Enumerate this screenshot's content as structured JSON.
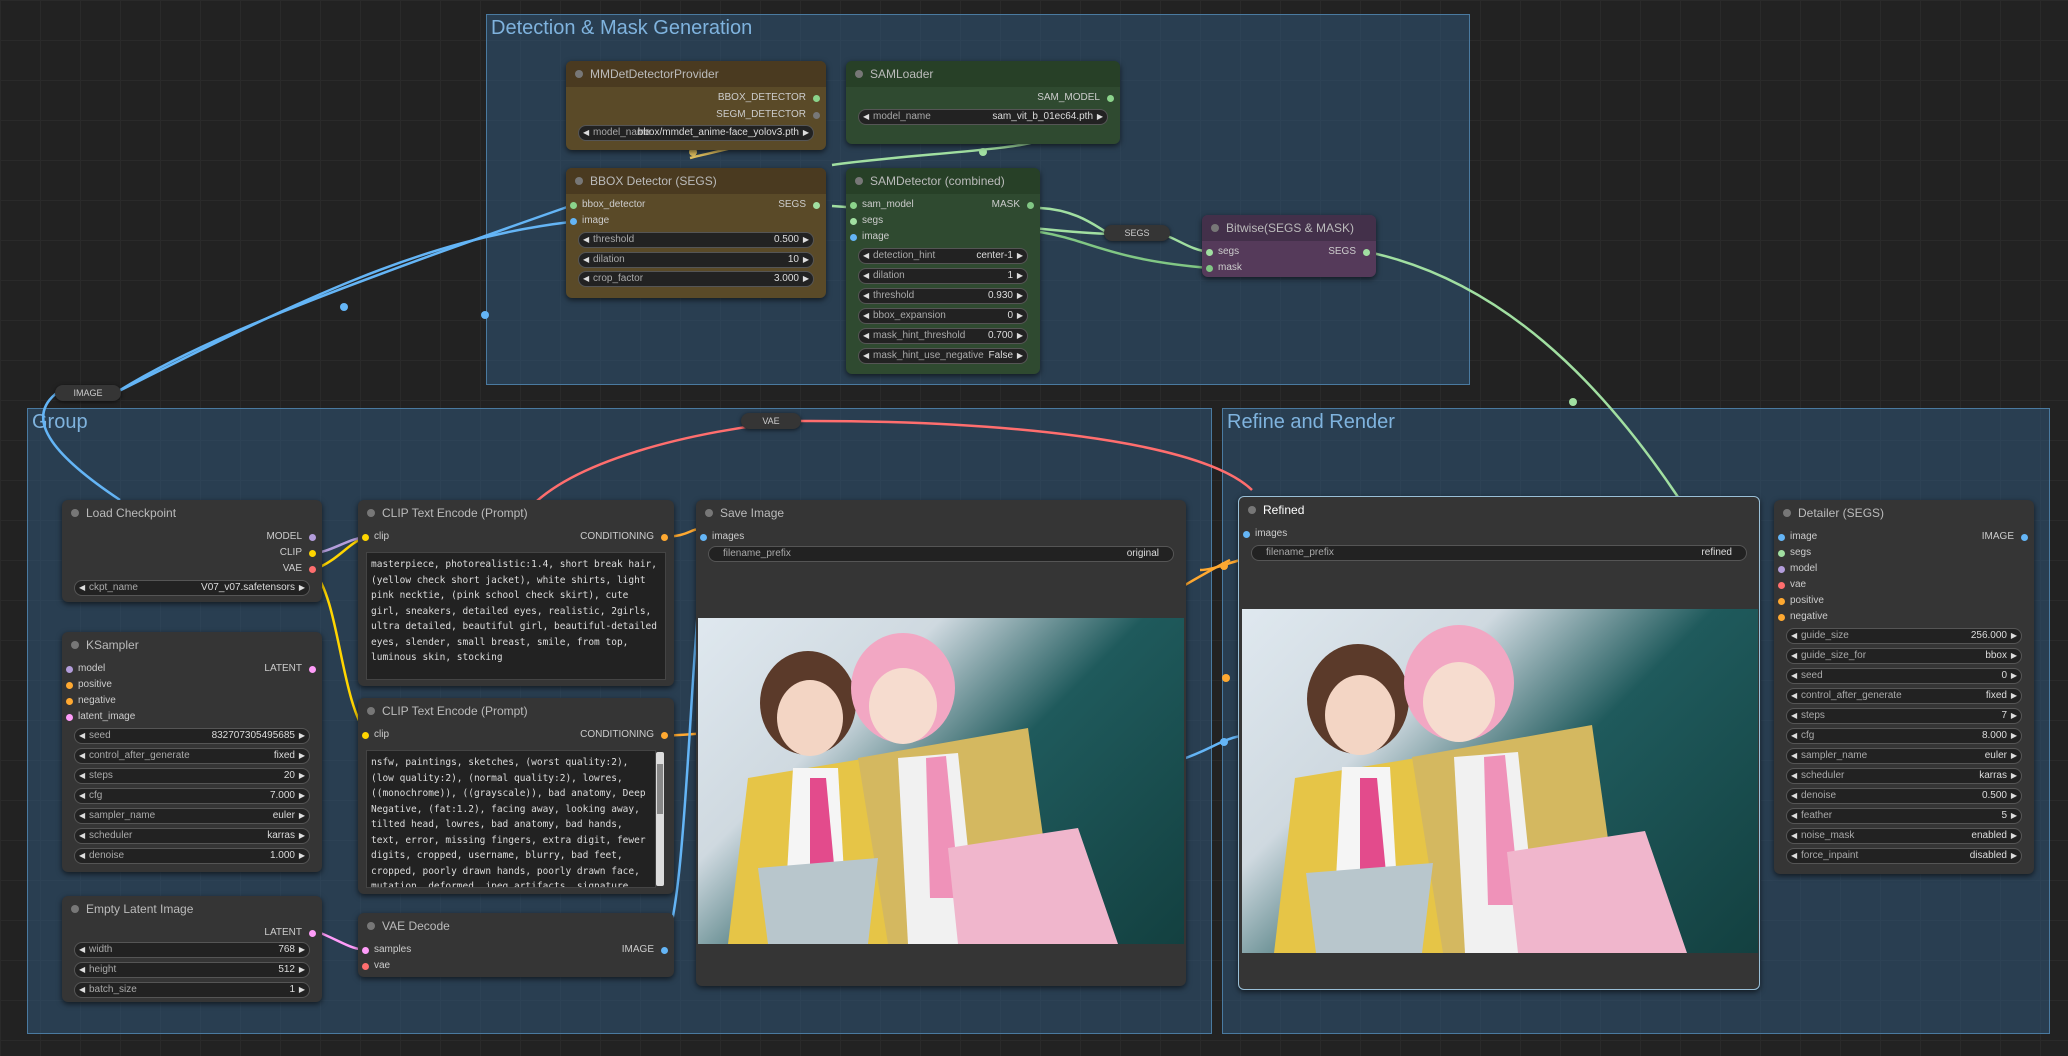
{
  "groups": {
    "detection": "Detection & Mask Generation",
    "group": "Group",
    "refine": "Refine and Render"
  },
  "mmdet": {
    "title": "MMDetDetectorProvider",
    "out1": "BBOX_DETECTOR",
    "out2": "SEGM_DETECTOR",
    "w_label": "model_name",
    "w_value": "bbox/mmdet_anime-face_yolov3.pth"
  },
  "samloader": {
    "title": "SAMLoader",
    "out": "SAM_MODEL",
    "w_label": "model_name",
    "w_value": "sam_vit_b_01ec64.pth"
  },
  "bbox": {
    "title": "BBOX Detector (SEGS)",
    "in1": "bbox_detector",
    "in2": "image",
    "out": "SEGS",
    "widgets": [
      {
        "label": "threshold",
        "value": "0.500"
      },
      {
        "label": "dilation",
        "value": "10"
      },
      {
        "label": "crop_factor",
        "value": "3.000"
      }
    ]
  },
  "samdet": {
    "title": "SAMDetector (combined)",
    "in1": "sam_model",
    "in2": "segs",
    "in3": "image",
    "out": "MASK",
    "widgets": [
      {
        "label": "detection_hint",
        "value": "center-1"
      },
      {
        "label": "dilation",
        "value": "1"
      },
      {
        "label": "threshold",
        "value": "0.930"
      },
      {
        "label": "bbox_expansion",
        "value": "0"
      },
      {
        "label": "mask_hint_threshold",
        "value": "0.700"
      },
      {
        "label": "mask_hint_use_negative",
        "value": "False"
      }
    ]
  },
  "reroutes": {
    "segs": "SEGS",
    "image": "IMAGE",
    "vae": "VAE"
  },
  "bitwise": {
    "title": "Bitwise(SEGS & MASK)",
    "in1": "segs",
    "in2": "mask",
    "out": "SEGS"
  },
  "checkpoint": {
    "title": "Load Checkpoint",
    "out1": "MODEL",
    "out2": "CLIP",
    "out3": "VAE",
    "w_label": "ckpt_name",
    "w_value": "V07_v07.safetensors"
  },
  "clip1": {
    "title": "CLIP Text Encode (Prompt)",
    "in": "clip",
    "out": "CONDITIONING",
    "text": "masterpiece, photorealistic:1.4, short break hair, (yellow check short jacket), white shirts, light pink necktie, (pink school check skirt), cute girl, sneakers, detailed eyes, realistic, 2girls, ultra detailed, beautiful girl, beautiful-detailed eyes, slender, small breast, smile, from top, luminous skin, stocking"
  },
  "clip2": {
    "title": "CLIP Text Encode (Prompt)",
    "in": "clip",
    "out": "CONDITIONING",
    "text": "nsfw, paintings, sketches, (worst quality:2), (low quality:2), (normal quality:2), lowres, ((monochrome)), ((grayscale)), bad anatomy, Deep Negative, (fat:1.2), facing away, looking away, tilted head, lowres, bad anatomy, bad hands, text, error, missing fingers, extra digit, fewer digits, cropped, username, blurry, bad feet, cropped, poorly drawn hands, poorly drawn face, mutation, deformed, jpeg artifacts, signature, watermark, extra fingers, fewer digits, extra limbs,"
  },
  "ksampler": {
    "title": "KSampler",
    "in1": "model",
    "in2": "positive",
    "in3": "negative",
    "in4": "latent_image",
    "out": "LATENT",
    "widgets": [
      {
        "label": "seed",
        "value": "832707305495685"
      },
      {
        "label": "control_after_generate",
        "value": "fixed"
      },
      {
        "label": "steps",
        "value": "20"
      },
      {
        "label": "cfg",
        "value": "7.000"
      },
      {
        "label": "sampler_name",
        "value": "euler"
      },
      {
        "label": "scheduler",
        "value": "karras"
      },
      {
        "label": "denoise",
        "value": "1.000"
      }
    ]
  },
  "latent": {
    "title": "Empty Latent Image",
    "out": "LATENT",
    "widgets": [
      {
        "label": "width",
        "value": "768"
      },
      {
        "label": "height",
        "value": "512"
      },
      {
        "label": "batch_size",
        "value": "1"
      }
    ]
  },
  "vaedecode": {
    "title": "VAE Decode",
    "in1": "samples",
    "in2": "vae",
    "out": "IMAGE"
  },
  "saveimage": {
    "title": "Save Image",
    "in": "images",
    "w_label": "filename_prefix",
    "w_value": "original"
  },
  "refined": {
    "title": "Refined",
    "in": "images",
    "w_label": "filename_prefix",
    "w_value": "refined"
  },
  "detailer": {
    "title": "Detailer (SEGS)",
    "in": [
      "image",
      "segs",
      "model",
      "vae",
      "positive",
      "negative"
    ],
    "out": "IMAGE",
    "widgets": [
      {
        "label": "guide_size",
        "value": "256.000"
      },
      {
        "label": "guide_size_for",
        "value": "bbox"
      },
      {
        "label": "seed",
        "value": "0"
      },
      {
        "label": "control_after_generate",
        "value": "fixed"
      },
      {
        "label": "steps",
        "value": "7"
      },
      {
        "label": "cfg",
        "value": "8.000"
      },
      {
        "label": "sampler_name",
        "value": "euler"
      },
      {
        "label": "scheduler",
        "value": "karras"
      },
      {
        "label": "denoise",
        "value": "0.500"
      },
      {
        "label": "feather",
        "value": "5"
      },
      {
        "label": "noise_mask",
        "value": "enabled"
      },
      {
        "label": "force_inpaint",
        "value": "disabled"
      }
    ]
  },
  "colors": {
    "image": "#64b5f6",
    "model": "#b39ddb",
    "clip": "#ffd500",
    "vae": "#ff6e6e",
    "conditioning": "#ffa931",
    "latent": "#ff9cf9",
    "segs": "#a1dfa1",
    "mask": "#81c784"
  }
}
